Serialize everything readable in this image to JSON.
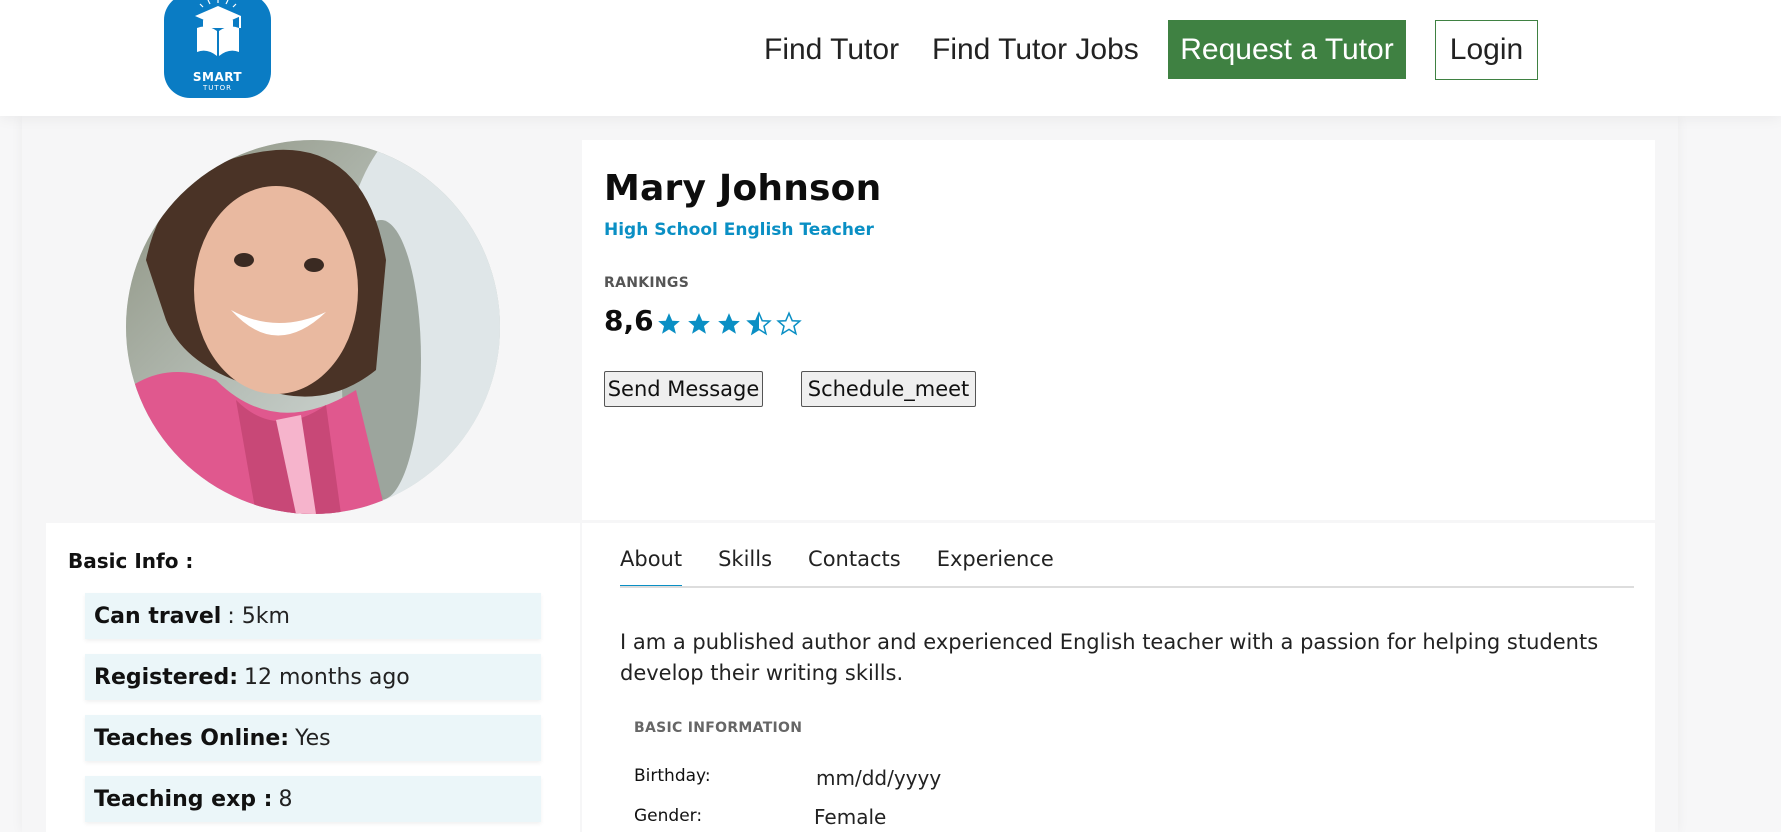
{
  "header": {
    "logo": {
      "line1": "SMART",
      "line2": "TUTOR"
    },
    "nav": [
      {
        "label": "Find Tutor"
      },
      {
        "label": "Find Tutor Jobs"
      }
    ],
    "request_label": "Request a Tutor",
    "login_label": "Login",
    "accent_color": "#3f8142"
  },
  "profile": {
    "name": "Mary Johnson",
    "title": "High School English Teacher",
    "rankings_label": "RANKINGS",
    "rating_value": "8,6",
    "stars": {
      "filled": 3,
      "half": 1,
      "empty": 1
    },
    "send_message_label": "Send Message",
    "schedule_label": "Schedule_meet",
    "accent_color": "#0a8fc4"
  },
  "basic_info": {
    "title": "Basic Info :",
    "rows": [
      {
        "key": "Can travel",
        "value": ": 5km"
      },
      {
        "key": "Registered:",
        "value": "12 months ago"
      },
      {
        "key": "Teaches Online:",
        "value": "Yes"
      },
      {
        "key": "Teaching exp :",
        "value": "8"
      }
    ]
  },
  "tabs": {
    "items": [
      {
        "label": "About"
      },
      {
        "label": "Skills"
      },
      {
        "label": "Contacts"
      },
      {
        "label": "Experience"
      }
    ],
    "active": "About",
    "about_text": "I am a published author and experienced English teacher with a passion for helping students develop their writing skills.",
    "basic_information_label": "BASIC INFORMATION",
    "fields": [
      {
        "label": "Birthday:",
        "value": "mm/dd/yyyy"
      },
      {
        "label": "Gender:",
        "value": "Female"
      }
    ]
  }
}
